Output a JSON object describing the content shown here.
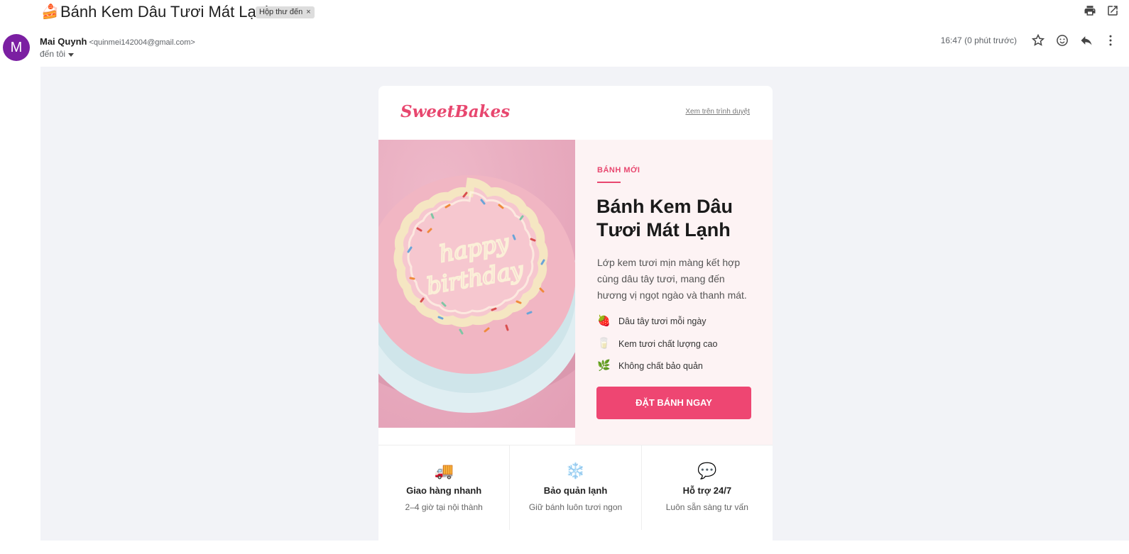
{
  "subject": {
    "emoji": "🍰",
    "title": "Bánh Kem Dâu Tươi Mát Lạnh",
    "label": "Hộp thư đến",
    "label_remove": "×"
  },
  "sender": {
    "avatar_letter": "M",
    "name": "Mai Quynh",
    "email": "<quinmei142004@gmail.com>",
    "to": "đến tôi",
    "time": "16:47 (0 phút trước)"
  },
  "icons": {
    "print": "print-icon",
    "open_new": "open-in-new-icon",
    "star": "star-icon",
    "emoji": "emoji-icon",
    "reply": "reply-icon",
    "more": "more-vert-icon"
  },
  "email": {
    "brand": "SweetBakes",
    "view_in_browser": "Xem trên trình duyệt",
    "cake_text": "happy birthday",
    "badge": "BÁNH MỚI",
    "title": "Bánh Kem Dâu Tươi Mát Lạnh",
    "description": "Lớp kem tươi mịn màng kết hợp cùng dâu tây tươi, mang đến hương vị ngọt ngào và thanh mát.",
    "features": [
      {
        "icon": "🍓",
        "label": "Dâu tây tươi mỗi ngày"
      },
      {
        "icon": "🥛",
        "label": "Kem tươi chất lượng cao"
      },
      {
        "icon": "🌿",
        "label": "Không chất bảo quản"
      }
    ],
    "cta": "ĐẶT BÁNH NGAY",
    "benefits": [
      {
        "icon": "🚚",
        "title": "Giao hàng nhanh",
        "sub": "2–4 giờ tại nội thành"
      },
      {
        "icon": "❄️",
        "title": "Bảo quản lạnh",
        "sub": "Giữ bánh luôn tươi ngon"
      },
      {
        "icon": "💬",
        "title": "Hỗ trợ 24/7",
        "sub": "Luôn sẵn sàng tư vấn"
      }
    ]
  },
  "colors": {
    "accent": "#e8476f",
    "cta": "#ee4672",
    "avatar": "#7b1fa2",
    "canvas": "#f2f3f7",
    "panel": "#fdf3f4"
  }
}
